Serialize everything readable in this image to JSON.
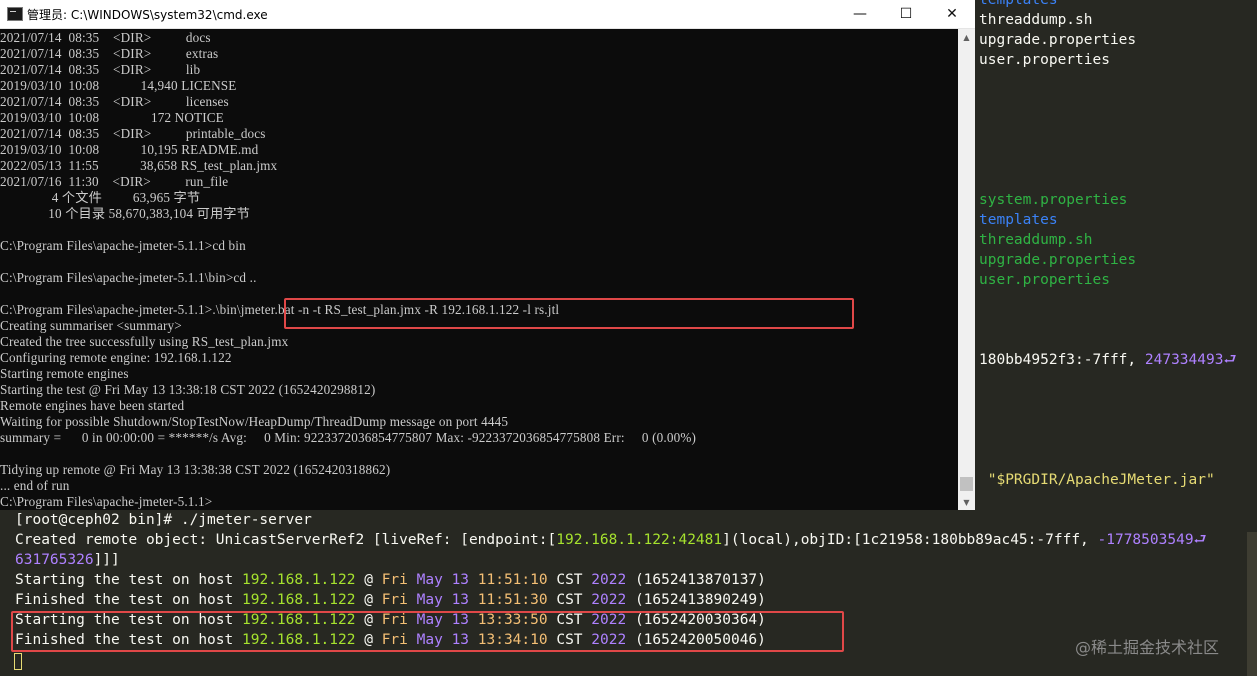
{
  "background_terminal": {
    "top_lines": [
      {
        "text": "templates",
        "color": "blue"
      },
      {
        "text": "threaddump.sh",
        "color": "white"
      },
      {
        "text": "upgrade.properties",
        "color": "white"
      },
      {
        "text": "user.properties",
        "color": "white"
      }
    ],
    "mid_lines": [
      {
        "text": "system.properties",
        "color": "green"
      },
      {
        "text": "templates",
        "color": "blue"
      },
      {
        "text": "threaddump.sh",
        "color": "green"
      },
      {
        "text": "upgrade.properties",
        "color": "green"
      },
      {
        "text": "user.properties",
        "color": "green"
      }
    ],
    "objid_tail": {
      "part1": "180bb4952f3",
      "part2": ":-7fff, ",
      "part3": "247334493",
      "wrap": "⮐"
    },
    "jar_line": " \"$PRGDIR/ApacheJMeter.jar\""
  },
  "cmd_window": {
    "title": "管理员: C:\\WINDOWS\\system32\\cmd.exe",
    "minimize_glyph": "—",
    "maximize_glyph": "☐",
    "close_glyph": "✕",
    "lines": [
      "2021/07/14  08:35    <DIR>          docs",
      "2021/07/14  08:35    <DIR>          extras",
      "2021/07/14  08:35    <DIR>          lib",
      "2019/03/10  10:08            14,940 LICENSE",
      "2021/07/14  08:35    <DIR>          licenses",
      "2019/03/10  10:08               172 NOTICE",
      "2021/07/14  08:35    <DIR>          printable_docs",
      "2019/03/10  10:08            10,195 README.md",
      "2022/05/13  11:55            38,658 RS_test_plan.jmx",
      "2021/07/16  11:30    <DIR>          run_file",
      "               4 个文件         63,965 字节",
      "              10 个目录 58,670,383,104 可用字节",
      "",
      "C:\\Program Files\\apache-jmeter-5.1.1>cd bin",
      "",
      "C:\\Program Files\\apache-jmeter-5.1.1\\bin>cd ..",
      "",
      "C:\\Program Files\\apache-jmeter-5.1.1>.\\bin\\jmeter.bat -n -t RS_test_plan.jmx -R 192.168.1.122 -l rs.jtl",
      "Creating summariser <summary>",
      "Created the tree successfully using RS_test_plan.jmx",
      "Configuring remote engine: 192.168.1.122",
      "Starting remote engines",
      "Starting the test @ Fri May 13 13:38:18 CST 2022 (1652420298812)",
      "Remote engines have been started",
      "Waiting for possible Shutdown/StopTestNow/HeapDump/ThreadDump message on port 4445",
      "summary =      0 in 00:00:00 = ******/s Avg:     0 Min: 9223372036854775807 Max: -9223372036854775808 Err:     0 (0.00%)",
      "",
      "Tidying up remote @ Fri May 13 13:38:38 CST 2022 (1652420318862)",
      "... end of run",
      "C:\\Program Files\\apache-jmeter-5.1.1>"
    ],
    "scroll_up": "▲",
    "scroll_down": "▼"
  },
  "ssh_terminal": {
    "prompt": "[root@ceph02 bin]# ./jmeter-server",
    "created_line": {
      "prefix": "Created remote object: UnicastServerRef2 [liveRef: [endpoint:[",
      "endpoint": "192.168.1.122:42481",
      "middle": "](local),objID:[1c21958:180bb89ac45:-7fff, ",
      "num": "-1778503549",
      "wrap": "⮐",
      "cont": "631765326",
      "close": "]]]"
    },
    "test_lines": [
      {
        "verb": "Starting the test on host",
        "ip": "192.168.1.122",
        "at": "@",
        "day": "Fri",
        "month": "May",
        "date": "13",
        "time": "11:51:10",
        "tz": "CST",
        "year": "2022",
        "stamp": "(1652413870137)"
      },
      {
        "verb": "Finished the test on host",
        "ip": "192.168.1.122",
        "at": "@",
        "day": "Fri",
        "month": "May",
        "date": "13",
        "time": "11:51:30",
        "tz": "CST",
        "year": "2022",
        "stamp": "(1652413890249)"
      },
      {
        "verb": "Starting the test on host",
        "ip": "192.168.1.122",
        "at": "@",
        "day": "Fri",
        "month": "May",
        "date": "13",
        "time": "13:33:50",
        "tz": "CST",
        "year": "2022",
        "stamp": "(1652420030364)"
      },
      {
        "verb": "Finished the test on host",
        "ip": "192.168.1.122",
        "at": "@",
        "day": "Fri",
        "month": "May",
        "date": "13",
        "time": "13:34:10",
        "tz": "CST",
        "year": "2022",
        "stamp": "(1652420050046)"
      }
    ],
    "watermark": "@稀土掘金技术社区"
  },
  "colors": {
    "highlight_box": "#e04848",
    "terminal_bg": "#272822",
    "cmd_bg": "#0c0c0c"
  }
}
